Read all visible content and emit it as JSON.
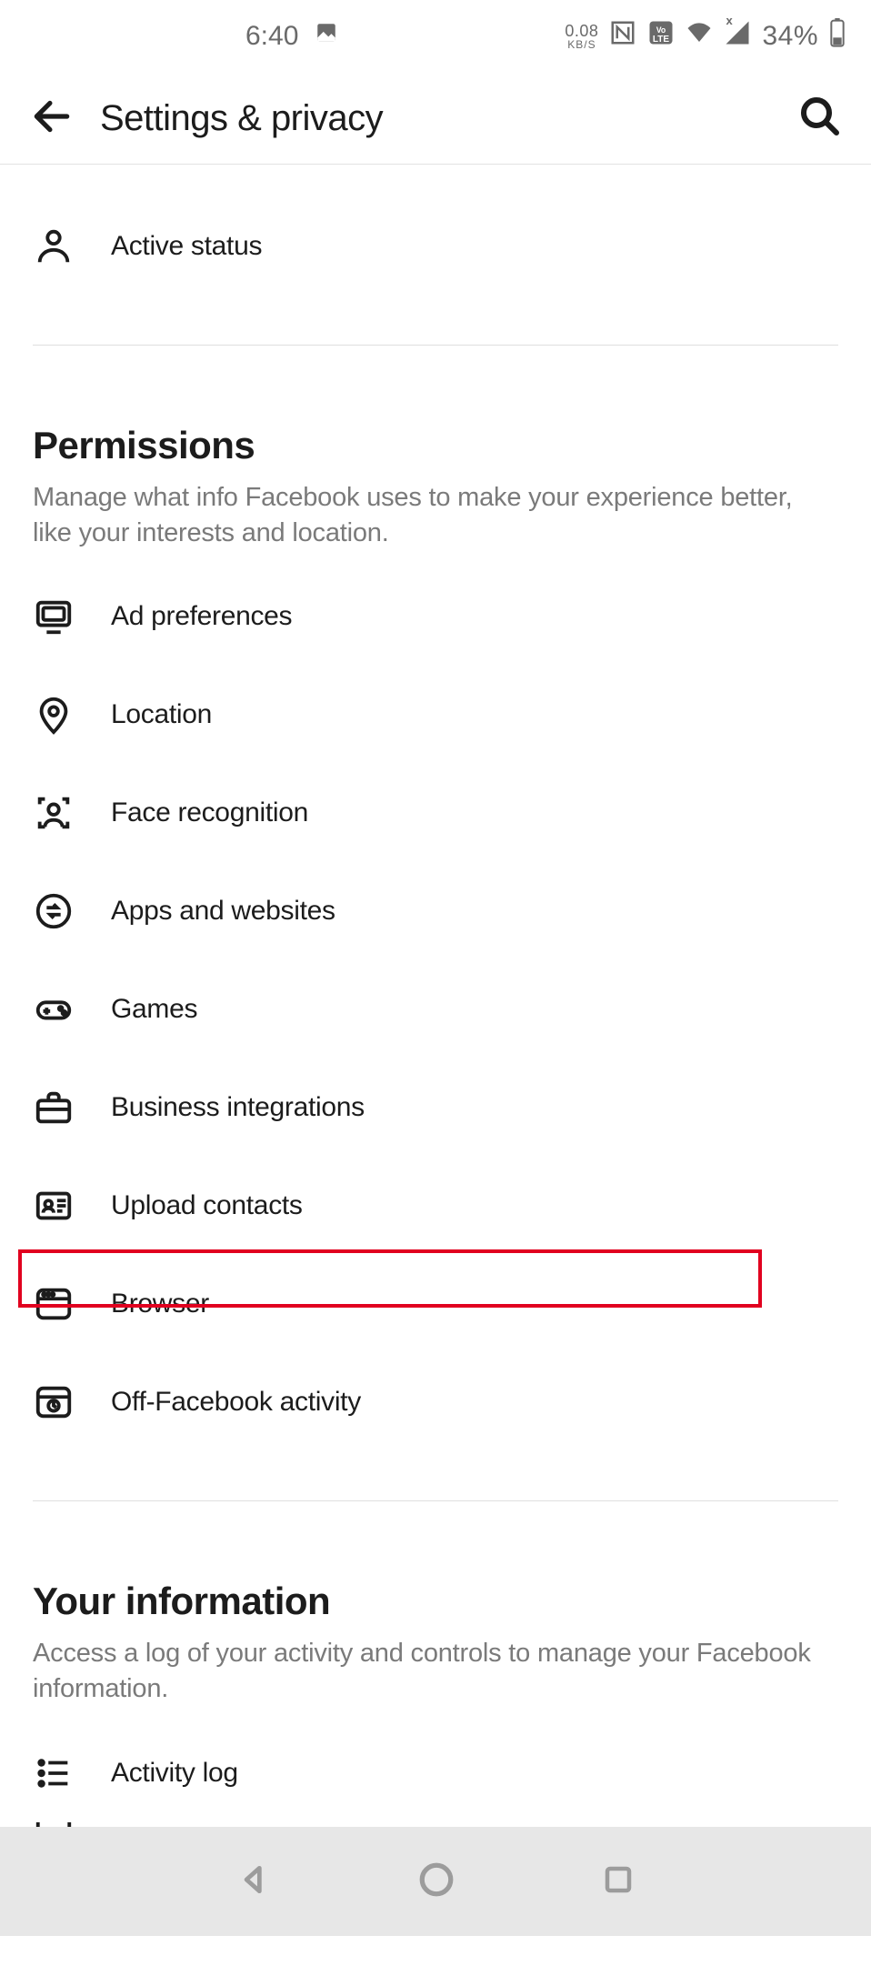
{
  "status": {
    "time": "6:40",
    "net_value": "0.08",
    "net_unit": "KB/S",
    "lte_badge": "LTE",
    "battery_pct": "34%"
  },
  "header": {
    "title": "Settings & privacy"
  },
  "first_row": {
    "label": "Active status"
  },
  "permissions": {
    "title": "Permissions",
    "desc": "Manage what info Facebook uses to make your experience better, like your interests and location.",
    "items": [
      {
        "label": "Ad preferences"
      },
      {
        "label": "Location"
      },
      {
        "label": "Face recognition"
      },
      {
        "label": "Apps and websites"
      },
      {
        "label": "Games"
      },
      {
        "label": "Business integrations"
      },
      {
        "label": "Upload contacts"
      },
      {
        "label": "Browser"
      },
      {
        "label": "Off-Facebook activity"
      }
    ]
  },
  "your_info": {
    "title": "Your information",
    "desc": "Access a log of your activity and controls to manage your Facebook information.",
    "items": [
      {
        "label": "Activity log"
      }
    ]
  }
}
